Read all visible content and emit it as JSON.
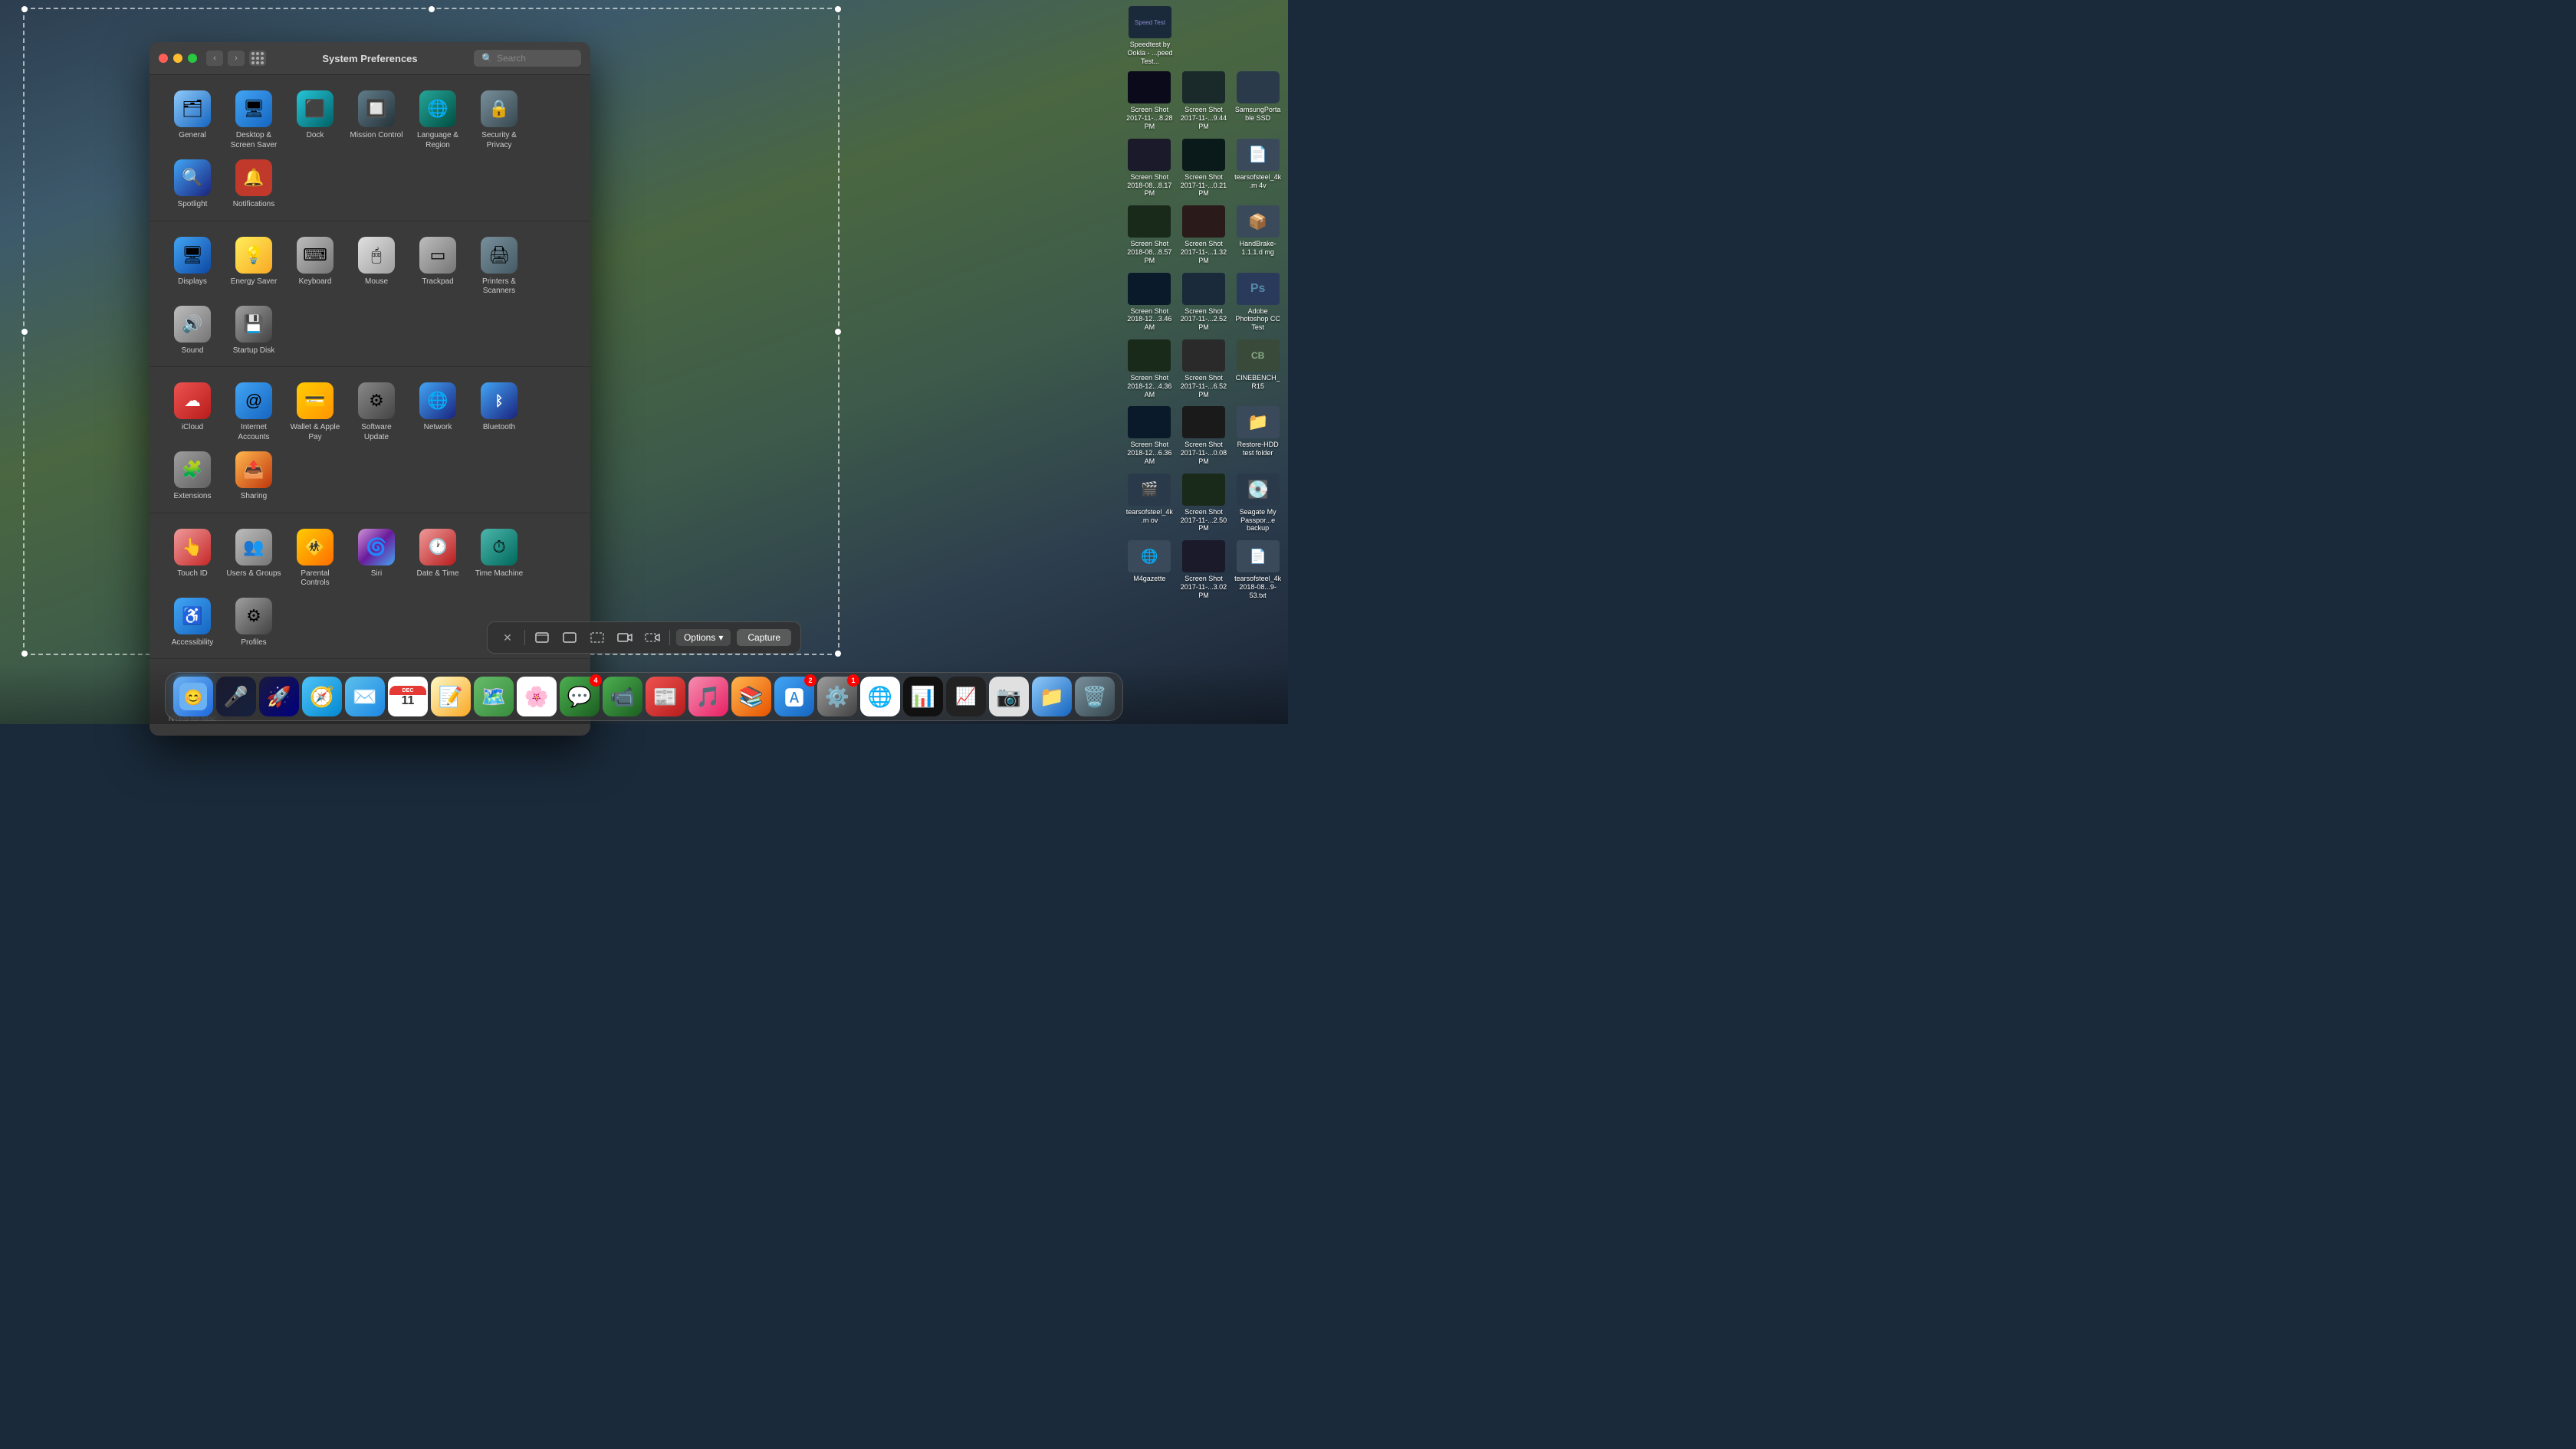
{
  "window": {
    "title": "System Preferences",
    "search_placeholder": "Search"
  },
  "sections": [
    {
      "id": "personal",
      "items": [
        {
          "id": "general",
          "label": "General",
          "icon": "pref-general",
          "emoji": "🗂"
        },
        {
          "id": "desktop",
          "label": "Desktop & Screen Saver",
          "icon": "pref-desktop",
          "emoji": "🖥"
        },
        {
          "id": "dock",
          "label": "Dock",
          "icon": "pref-dock",
          "emoji": "⬛"
        },
        {
          "id": "mission",
          "label": "Mission Control",
          "icon": "pref-mission",
          "emoji": "🔲"
        },
        {
          "id": "language",
          "label": "Language & Region",
          "icon": "pref-language",
          "emoji": "🌐"
        },
        {
          "id": "security",
          "label": "Security & Privacy",
          "icon": "pref-security",
          "emoji": "🔒"
        },
        {
          "id": "spotlight",
          "label": "Spotlight",
          "icon": "pref-spotlight",
          "emoji": "🔍"
        },
        {
          "id": "notifications",
          "label": "Notifications",
          "icon": "pref-notifications",
          "emoji": "🔴"
        }
      ]
    },
    {
      "id": "hardware",
      "items": [
        {
          "id": "displays",
          "label": "Displays",
          "icon": "pref-displays",
          "emoji": "🖥"
        },
        {
          "id": "energy",
          "label": "Energy Saver",
          "icon": "pref-energy",
          "emoji": "💡"
        },
        {
          "id": "keyboard",
          "label": "Keyboard",
          "icon": "pref-keyboard",
          "emoji": "⌨"
        },
        {
          "id": "mouse",
          "label": "Mouse",
          "icon": "pref-mouse",
          "emoji": "🖱"
        },
        {
          "id": "trackpad",
          "label": "Trackpad",
          "icon": "pref-trackpad",
          "emoji": "▭"
        },
        {
          "id": "printers",
          "label": "Printers & Scanners",
          "icon": "pref-printers",
          "emoji": "🖨"
        },
        {
          "id": "sound",
          "label": "Sound",
          "icon": "pref-sound",
          "emoji": "🔊"
        },
        {
          "id": "startup",
          "label": "Startup Disk",
          "icon": "pref-startup",
          "emoji": "💾"
        }
      ]
    },
    {
      "id": "internet",
      "items": [
        {
          "id": "icloud",
          "label": "iCloud",
          "icon": "pref-icloud",
          "emoji": "☁"
        },
        {
          "id": "internet",
          "label": "Internet Accounts",
          "icon": "pref-internet",
          "emoji": "🌐"
        },
        {
          "id": "wallet",
          "label": "Wallet & Apple Pay",
          "icon": "pref-wallet",
          "emoji": "💳"
        },
        {
          "id": "software",
          "label": "Software Update",
          "icon": "pref-software",
          "emoji": "⚙"
        },
        {
          "id": "network",
          "label": "Network",
          "icon": "pref-network",
          "emoji": "🌐"
        },
        {
          "id": "bluetooth",
          "label": "Bluetooth",
          "icon": "pref-bluetooth",
          "emoji": "₿"
        },
        {
          "id": "extensions",
          "label": "Extensions",
          "icon": "pref-extensions",
          "emoji": "🧩"
        },
        {
          "id": "sharing",
          "label": "Sharing",
          "icon": "pref-sharing",
          "emoji": "📤"
        }
      ]
    },
    {
      "id": "system",
      "items": [
        {
          "id": "touchid",
          "label": "Touch ID",
          "icon": "pref-touchid",
          "emoji": "👆"
        },
        {
          "id": "users",
          "label": "Users & Groups",
          "icon": "pref-users",
          "emoji": "👥"
        },
        {
          "id": "parental",
          "label": "Parental Controls",
          "icon": "pref-parental",
          "emoji": "🚸"
        },
        {
          "id": "siri",
          "label": "Siri",
          "icon": "pref-siri",
          "emoji": "🌀"
        },
        {
          "id": "datetime",
          "label": "Date & Time",
          "icon": "pref-datetime",
          "emoji": "🕐"
        },
        {
          "id": "timemachine",
          "label": "Time Machine",
          "icon": "pref-timemachine",
          "emoji": "⏱"
        },
        {
          "id": "accessibility",
          "label": "Accessibility",
          "icon": "pref-accessibility",
          "emoji": "♿"
        },
        {
          "id": "profiles",
          "label": "Profiles",
          "icon": "pref-profiles",
          "emoji": "⚙"
        }
      ]
    },
    {
      "id": "other",
      "items": [
        {
          "id": "ntfs",
          "label": "NTFS for Mac",
          "icon": "pref-ntfs",
          "emoji": "🗄"
        }
      ]
    }
  ],
  "capture_toolbar": {
    "options_label": "Options",
    "capture_label": "Capture"
  },
  "dock": {
    "items": [
      {
        "id": "finder",
        "label": "Finder",
        "emoji": "🔵",
        "class": "icon-finder"
      },
      {
        "id": "siri",
        "label": "Siri",
        "emoji": "🎤",
        "class": "icon-siri"
      },
      {
        "id": "launchpad",
        "label": "Launchpad",
        "emoji": "🚀",
        "class": "icon-launchpad"
      },
      {
        "id": "safari",
        "label": "Safari",
        "emoji": "🧭",
        "class": "icon-safari"
      },
      {
        "id": "mail",
        "label": "Mail",
        "emoji": "✉",
        "class": "icon-mail"
      },
      {
        "id": "calendar",
        "label": "Calendar",
        "emoji": "📅",
        "class": "icon-calendar"
      },
      {
        "id": "notes",
        "label": "Notes",
        "emoji": "📝",
        "class": "icon-notes"
      },
      {
        "id": "maps",
        "label": "Maps",
        "emoji": "🗺",
        "class": "icon-maps"
      },
      {
        "id": "photos",
        "label": "Photos",
        "emoji": "🌸",
        "class": "icon-photos"
      },
      {
        "id": "messages",
        "label": "Messages",
        "emoji": "💬",
        "class": "icon-messages",
        "badge": "4"
      },
      {
        "id": "facetime",
        "label": "FaceTime",
        "emoji": "📹",
        "class": "icon-facetime"
      },
      {
        "id": "news",
        "label": "News",
        "emoji": "📰",
        "class": "icon-news"
      },
      {
        "id": "music",
        "label": "Music",
        "emoji": "🎵",
        "class": "icon-music"
      },
      {
        "id": "books",
        "label": "Books",
        "emoji": "📚",
        "class": "icon-books"
      },
      {
        "id": "appstore",
        "label": "App Store",
        "emoji": "🅰",
        "class": "icon-appstore",
        "badge": "2"
      },
      {
        "id": "sysprefs",
        "label": "System Preferences",
        "emoji": "⚙",
        "class": "icon-sysprefs2",
        "badge": "1"
      },
      {
        "id": "chrome",
        "label": "Chrome",
        "emoji": "🌐",
        "class": "icon-chrome"
      },
      {
        "id": "istatmenus",
        "label": "iStat Menus",
        "emoji": "📊",
        "class": "icon-istatmenus"
      },
      {
        "id": "istatmenus2",
        "label": "iStat Menus 2",
        "emoji": "📈",
        "class": "icon-istatmenus2"
      },
      {
        "id": "screenshots",
        "label": "Screenshots",
        "emoji": "📷",
        "class": "icon-screenshots"
      },
      {
        "id": "folder",
        "label": "Folder",
        "emoji": "📁",
        "class": "icon-folder"
      },
      {
        "id": "trash",
        "label": "Trash",
        "emoji": "🗑",
        "class": "icon-trash"
      }
    ]
  },
  "desktop_files": [
    {
      "label": "Speedtest by Ookla - ...peed Test..."
    },
    {
      "label": "Screen Shot 2017-11-...8.28 PM"
    },
    {
      "label": "Screen Shot 2017-11-...9.44 PM"
    },
    {
      "label": "SamsungPortable SSD"
    },
    {
      "label": "Screen Shot 2018-08...8.17 PM"
    },
    {
      "label": "Screen Shot 2017-11-...0.21 PM"
    },
    {
      "label": "tearsofsteel_4k.m 4v"
    },
    {
      "label": "Screen Shot 2018-08...8.57 PM"
    },
    {
      "label": "Screen Shot 2017-11-...1.32 PM"
    },
    {
      "label": "HandBrake-1.1.1.d mg"
    },
    {
      "label": "Screen Shot 2018-12...3.46 AM"
    },
    {
      "label": "Screen Shot 2017-11-...2.52 PM"
    },
    {
      "label": "Adobe Photoshop CC Test"
    },
    {
      "label": "Screen Shot 2018-12...4.36 AM"
    },
    {
      "label": "Screen Shot 2017-11-...6.52 PM"
    },
    {
      "label": "CINEBENCH_R15"
    },
    {
      "label": "Screen Shot 2018-12...6.36 AM"
    },
    {
      "label": "Screen Shot 2017-11-...0.08 PM"
    },
    {
      "label": "Restore-HDD test folder"
    },
    {
      "label": "tearsofsteel_4k.m ov"
    },
    {
      "label": "Screen Shot 2017-11-...2.50 PM"
    },
    {
      "label": "Seagate My Passpor...e backup"
    },
    {
      "label": "M4gazette"
    },
    {
      "label": "Screen Shot 2017-11-...3.02 PM"
    },
    {
      "label": "tearsofsteel_4k 2018-08...9-53.txt"
    }
  ]
}
